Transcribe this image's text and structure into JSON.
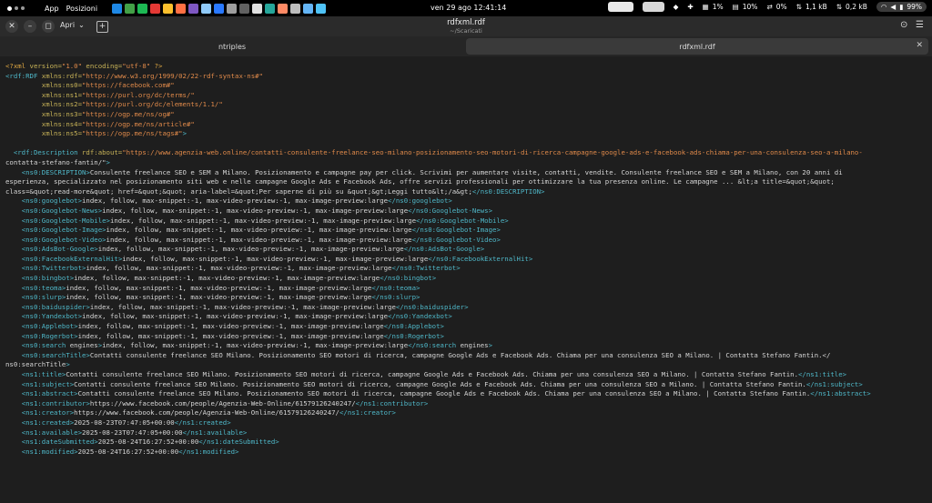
{
  "topbar": {
    "app_label": "App",
    "places_label": "Posizioni",
    "clock": "ven 29 ago  12:41:14",
    "stats": [
      "1%",
      "10%",
      "0%",
      "1,1 kB",
      "0,2 kB"
    ],
    "battery": "99%",
    "app_icon_colors": [
      "#1e88e5",
      "#43a047",
      "#1db954",
      "#e53935",
      "#fbc02d",
      "#ff7043",
      "#7e57c2",
      "#90caf9",
      "#2979ff",
      "#9e9e9e",
      "#616161",
      "#e0e0e0",
      "#26a69a",
      "#ff8a65",
      "#bdbdbd",
      "#64b5f6",
      "#4fc3f7"
    ]
  },
  "window": {
    "open_label": "Apri",
    "title": "rdfxml.rdf",
    "subtitle": "~/Scaricati"
  },
  "tabs": [
    {
      "label": "ntriples"
    },
    {
      "label": "rdfxml.rdf"
    }
  ],
  "code_lines": [
    "<?xml version=\"1.0\" encoding=\"utf-8\" ?>",
    "<rdf:RDF xmlns:rdf=\"http://www.w3.org/1999/02/22-rdf-syntax-ns#\"",
    "         xmlns:ns0=\"https://facebook.com#\"",
    "         xmlns:ns1=\"https://purl.org/dc/terms/\"",
    "         xmlns:ns2=\"https://purl.org/dc/elements/1.1/\"",
    "         xmlns:ns3=\"https://ogp.me/ns/og#\"",
    "         xmlns:ns4=\"https://ogp.me/ns/article#\"",
    "         xmlns:ns5=\"https://ogp.me/ns/tags#\">",
    "",
    "  <rdf:Description rdf:about=\"https://www.agenzia-web.online/contatti-consulente-freelance-seo-milano-posizionamento-seo-motori-di-ricerca-campagne-google-ads-e-facebook-ads-chiama-per-una-consulenza-seo-a-milano-",
    "contatta-stefano-fantin/\">",
    "    <ns0:DESCRIPTION>Consulente freelance SEO e SEM a Milano. Posizionamento e campagne pay per click. Scrivimi per aumentare visite, contatti, vendite. Consulente freelance SEO e SEM a Milano, con 20 anni di",
    "esperienza, specializzato nel posizionamento siti web e nelle campagne Google Ads e Facebook Ads, offre servizi professionali per ottimizzare la tua presenza online. Le campagne ... &lt;a title=&quot;&quot;",
    "class=&quot;read-more&quot; href=&quot;&quot; aria-label=&quot;Per saperne di più su &quot;&gt;Leggi tutto&lt;/a&gt;</ns0:DESCRIPTION>",
    "    <ns0:googlebot>index, follow, max-snippet:-1, max-video-preview:-1, max-image-preview:large</ns0:googlebot>",
    "    <ns0:Googlebot-News>index, follow, max-snippet:-1, max-video-preview:-1, max-image-preview:large</ns0:Googlebot-News>",
    "    <ns0:Googlebot-Mobile>index, follow, max-snippet:-1, max-video-preview:-1, max-image-preview:large</ns0:Googlebot-Mobile>",
    "    <ns0:Googlebot-Image>index, follow, max-snippet:-1, max-video-preview:-1, max-image-preview:large</ns0:Googlebot-Image>",
    "    <ns0:Googlebot-Video>index, follow, max-snippet:-1, max-video-preview:-1, max-image-preview:large</ns0:Googlebot-Video>",
    "    <ns0:AdsBot-Google>index, follow, max-snippet:-1, max-video-preview:-1, max-image-preview:large</ns0:AdsBot-Google>",
    "    <ns0:FacebookExternalHit>index, follow, max-snippet:-1, max-video-preview:-1, max-image-preview:large</ns0:FacebookExternalHit>",
    "    <ns0:Twitterbot>index, follow, max-snippet:-1, max-video-preview:-1, max-image-preview:large</ns0:Twitterbot>",
    "    <ns0:bingbot>index, follow, max-snippet:-1, max-video-preview:-1, max-image-preview:large</ns0:bingbot>",
    "    <ns0:teoma>index, follow, max-snippet:-1, max-video-preview:-1, max-image-preview:large</ns0:teoma>",
    "    <ns0:slurp>index, follow, max-snippet:-1, max-video-preview:-1, max-image-preview:large</ns0:slurp>",
    "    <ns0:baiduspider>index, follow, max-snippet:-1, max-video-preview:-1, max-image-preview:large</ns0:baiduspider>",
    "    <ns0:Yandexbot>index, follow, max-snippet:-1, max-video-preview:-1, max-image-preview:large</ns0:Yandexbot>",
    "    <ns0:Applebot>index, follow, max-snippet:-1, max-video-preview:-1, max-image-preview:large</ns0:Applebot>",
    "    <ns0:Rogerbot>index, follow, max-snippet:-1, max-video-preview:-1, max-image-preview:large</ns0:Rogerbot>",
    "    <ns0:search engines>index, follow, max-snippet:-1, max-video-preview:-1, max-image-preview:large</ns0:search engines>",
    "    <ns0:searchTitle>Contatti consulente freelance SEO Milano. Posizionamento SEO motori di ricerca, campagne Google Ads e Facebook Ads. Chiama per una consulenza SEO a Milano. | Contatta Stefano Fantin.</",
    "ns0:searchTitle>",
    "    <ns1:title>Contatti consulente freelance SEO Milano. Posizionamento SEO motori di ricerca, campagne Google Ads e Facebook Ads. Chiama per una consulenza SEO a Milano. | Contatta Stefano Fantin.</ns1:title>",
    "    <ns1:subject>Contatti consulente freelance SEO Milano. Posizionamento SEO motori di ricerca, campagne Google Ads e Facebook Ads. Chiama per una consulenza SEO a Milano. | Contatta Stefano Fantin.</ns1:subject>",
    "    <ns1:abstract>Contatti consulente freelance SEO Milano. Posizionamento SEO motori di ricerca, campagne Google Ads e Facebook Ads. Chiama per una consulenza SEO a Milano. | Contatta Stefano Fantin.</ns1:abstract>",
    "    <ns1:contributor>https://www.facebook.com/people/Agenzia-Web-Online/61579126240247/</ns1:contributor>",
    "    <ns1:creator>https://www.facebook.com/people/Agenzia-Web-Online/61579126240247/</ns1:creator>",
    "    <ns1:created>2025-08-23T07:47:05+00:00</ns1:created>",
    "    <ns1:available>2025-08-23T07:47:05+00:00</ns1:available>",
    "    <ns1:dateSubmitted>2025-08-24T16:27:52+00:00</ns1:dateSubmitted>",
    "    <ns1:modified>2025-08-24T16:27:52+00:00</ns1:modified>"
  ]
}
